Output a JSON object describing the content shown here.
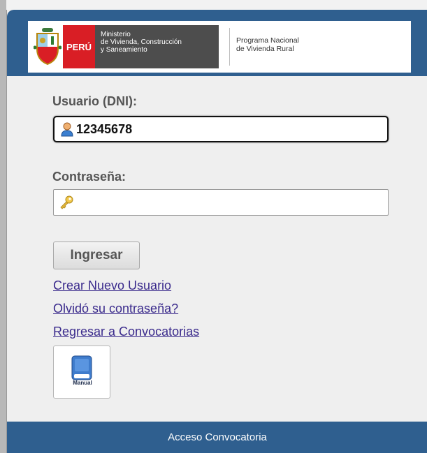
{
  "banner": {
    "country": "PERÚ",
    "ministry_lines": [
      "Ministerio",
      "de Vivienda, Construcción",
      "y Saneamiento"
    ],
    "program_lines": [
      "Programa Nacional",
      "de Vivienda Rural"
    ]
  },
  "form": {
    "user_label": "Usuario (DNI):",
    "user_value": "12345678",
    "user_icon": "user-icon",
    "password_label": "Contraseña:",
    "password_value": "",
    "password_icon": "key-icon",
    "submit_label": "Ingresar"
  },
  "links": {
    "create_user": "Crear Nuevo Usuario",
    "forgot_password": "Olvidó su contraseña?",
    "back_to_calls": "Regresar a Convocatorias"
  },
  "manual": {
    "label": "Manual",
    "icon": "book-icon"
  },
  "footer": {
    "title": "Acceso Convocatoria"
  },
  "colors": {
    "header_blue": "#2f5f8f",
    "peru_red": "#d91e25",
    "ministry_gray": "#4d4d4d",
    "link_purple": "#3a2a8c"
  }
}
